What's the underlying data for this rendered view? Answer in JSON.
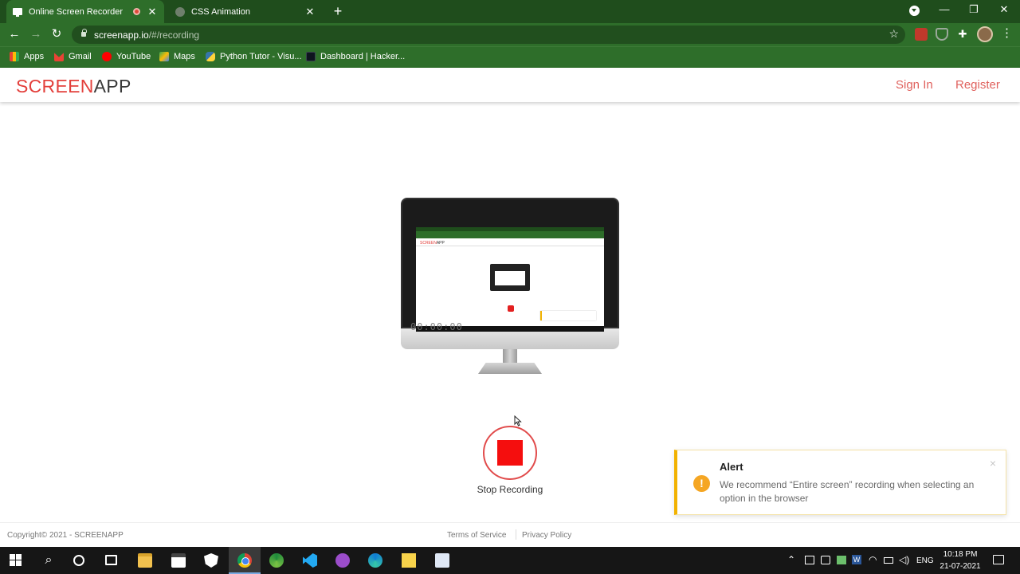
{
  "browser": {
    "tabs": [
      {
        "title": "Online Screen Recorder",
        "active": true
      },
      {
        "title": "CSS Animation",
        "active": false
      }
    ],
    "url_host": "screenapp.io",
    "url_path": "/#/recording",
    "bookmarks": [
      {
        "label": "Apps"
      },
      {
        "label": "Gmail"
      },
      {
        "label": "YouTube"
      },
      {
        "label": "Maps"
      },
      {
        "label": "Python Tutor - Visu..."
      },
      {
        "label": "Dashboard | Hacker..."
      }
    ]
  },
  "site": {
    "logo_part1": "SCREEN",
    "logo_part2": "APP",
    "signin_label": "Sign In",
    "register_label": "Register",
    "accent_color": "#e3403c"
  },
  "preview": {
    "timer": "00:00:00"
  },
  "recording": {
    "stop_label": "Stop Recording",
    "stop_color": "#f50e0e"
  },
  "alert": {
    "title": "Alert",
    "message": "We recommend “Entire screen” recording when selecting an option in the browser",
    "icon": "!",
    "close": "×",
    "accent_color": "#f2b200"
  },
  "footer": {
    "copyright": "Copyright©  2021 - SCREENAPP",
    "terms": "Terms of Service",
    "privacy": "Privacy Policy"
  },
  "taskbar": {
    "lang": "ENG",
    "time": "10:18 PM",
    "date": "21-07-2021"
  }
}
